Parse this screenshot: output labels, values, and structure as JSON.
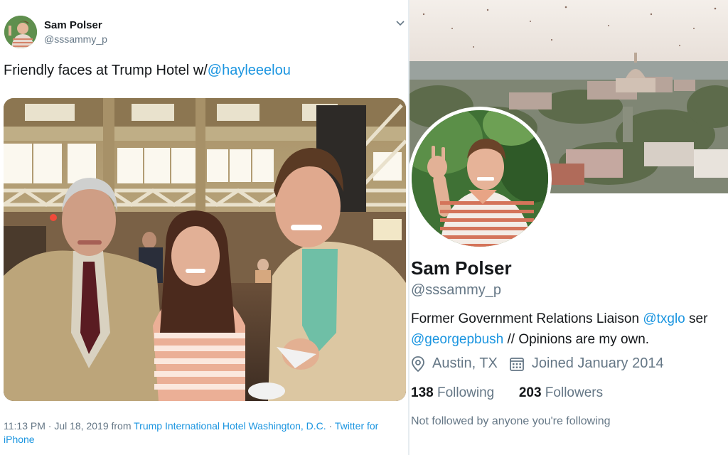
{
  "tweet": {
    "author_name": "Sam Polser",
    "author_handle": "@sssammy_p",
    "text": "Friendly faces at Trump Hotel w/",
    "mention": "@hayleeelou",
    "time": "11:13 PM · Jul 18, 2019 from ",
    "location": "Trump International Hotel Washington, D.C.",
    "separator": " · ",
    "source": "Twitter for iPhone",
    "icons": [
      "chevron-down-icon"
    ]
  },
  "profile": {
    "name": "Sam Polser",
    "handle": "@sssammy_p",
    "bio_part1": "Former Government Relations Liaison ",
    "bio_mention1": "@txglo",
    "bio_part2": " ser",
    "bio_mention2": "@georgepbush",
    "bio_part3": " // Opinions are my own.",
    "location": "Austin, TX",
    "joined": "Joined January 2014",
    "following_count": "138",
    "following_label": "Following",
    "followers_count": "203",
    "followers_label": "Followers",
    "note": "Not followed by anyone you're following",
    "icons": [
      "location-pin-icon",
      "calendar-icon"
    ]
  },
  "colors": {
    "link": "#1b95e0",
    "secondary": "#657786",
    "text": "#14171a"
  }
}
